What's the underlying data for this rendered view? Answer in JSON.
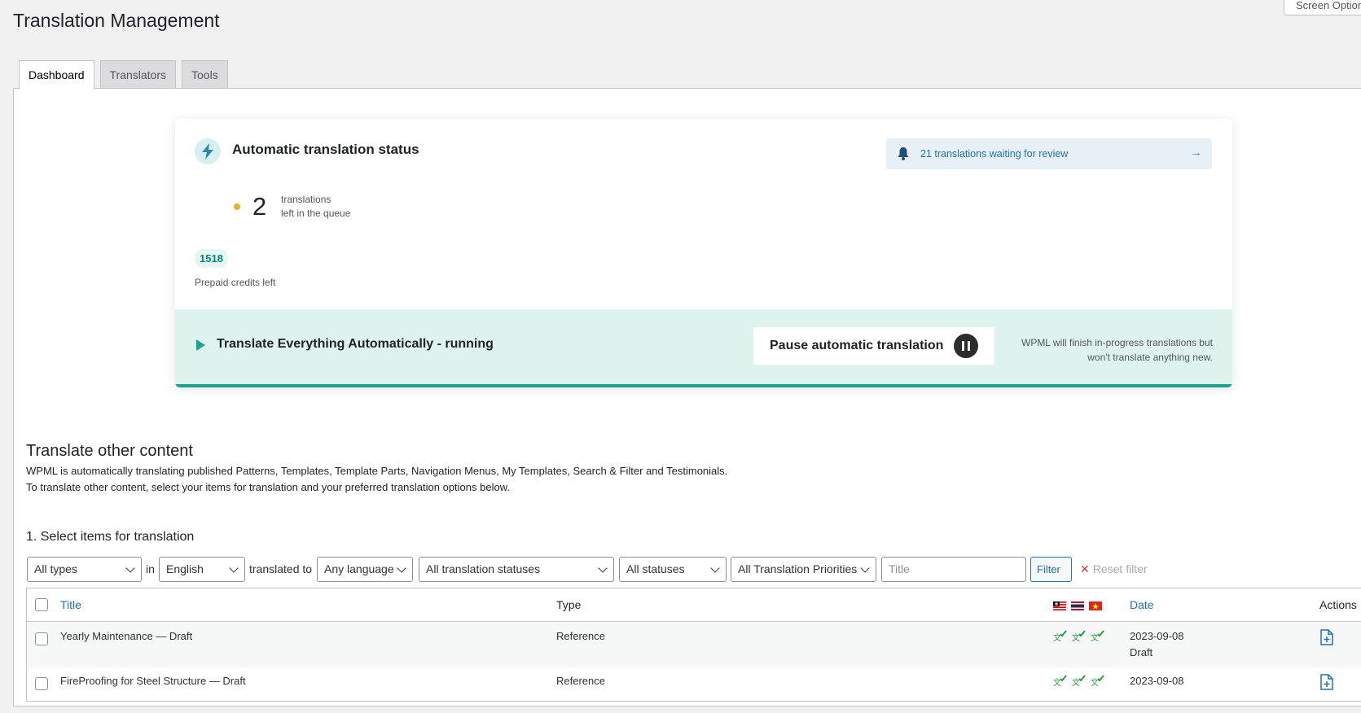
{
  "header": {
    "title": "Translation Management",
    "screen_options": "Screen Options"
  },
  "tabs": [
    {
      "label": "Dashboard",
      "active": true
    },
    {
      "label": "Translators",
      "active": false
    },
    {
      "label": "Tools",
      "active": false
    }
  ],
  "status_card": {
    "title": "Automatic translation status",
    "review_notice": "21 translations waiting for review",
    "queue_count": "2",
    "queue_label_1": "translations",
    "queue_label_2": "left in the queue",
    "credits_value": "1518",
    "credits_label": "Prepaid credits left",
    "running_text": "Translate Everything Automatically - running",
    "pause_button": "Pause automatic translation",
    "note_line_1": "WPML will finish in-progress translations but",
    "note_line_2": "won't translate anything new.",
    "accent_color": "#1aa38a",
    "queue_dot_color": "#e5b32c"
  },
  "other_content": {
    "heading": "Translate other content",
    "line_1": "WPML is automatically translating published Patterns, Templates, Template Parts, Navigation Menus, My Templates, Search & Filter and Testimonials.",
    "line_2": "To translate other content, select your items for translation and your preferred translation options below.",
    "step_heading": "1. Select items for translation"
  },
  "filters": {
    "type": "All types",
    "in_word": "in",
    "language": "English",
    "translated_to_word": "translated to",
    "target_language": "Any language",
    "translation_status": "All translation statuses",
    "status": "All statuses",
    "priority": "All Translation Priorities",
    "title_placeholder": "Title",
    "filter_button": "Filter",
    "reset_filter": "Reset filter"
  },
  "table": {
    "columns": {
      "title": "Title",
      "type": "Type",
      "languages": [
        "ms-flag-icon",
        "th-flag-icon",
        "vn-flag-icon"
      ],
      "date": "Date",
      "actions": "Actions"
    },
    "rows": [
      {
        "title": "Yearly Maintenance — Draft",
        "type": "Reference",
        "date": "2023-09-08",
        "status": "Draft"
      },
      {
        "title": "FireProofing for Steel Structure — Draft",
        "type": "Reference",
        "date": "2023-09-08",
        "status": ""
      }
    ]
  }
}
